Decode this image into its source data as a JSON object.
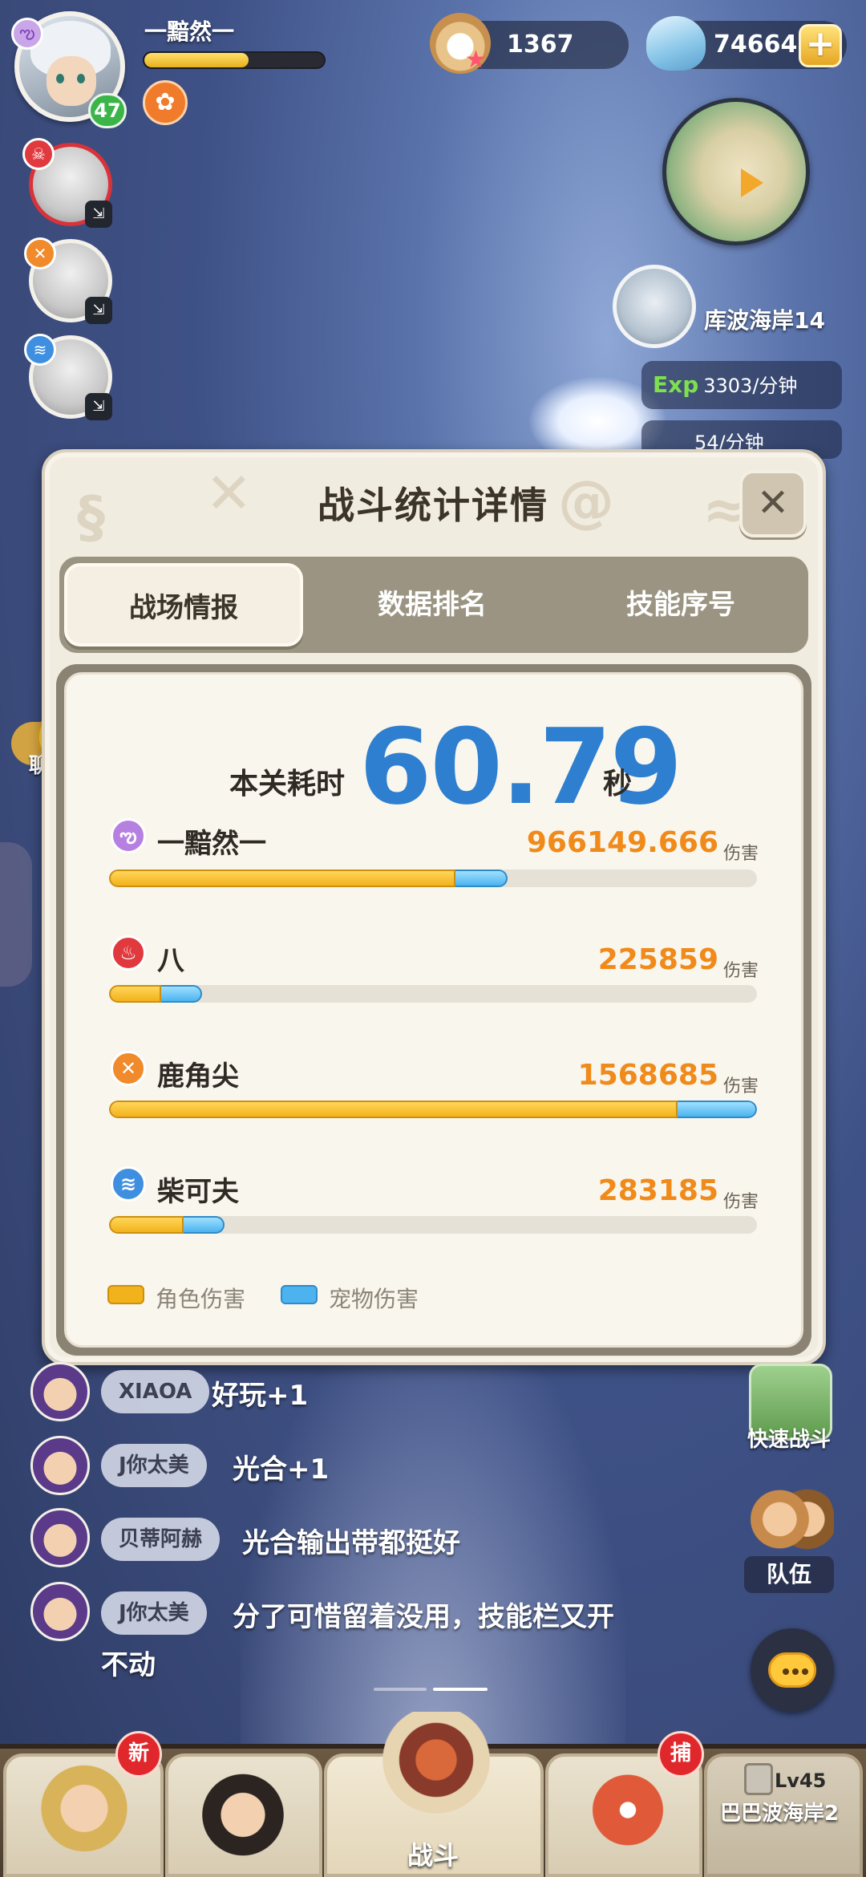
{
  "colors": {
    "accent_blue": "#2e7fd0",
    "damage_orange": "#f08a1a",
    "character_bar": "#f2b21c",
    "pet_bar": "#4cb3ef",
    "panel_bg": "#f9f6ee"
  },
  "hud": {
    "player_name": "一黯然一",
    "player_level": "47",
    "player_exp_fraction": 0.58,
    "pearls": "1367",
    "shells": "74664",
    "stage_name": "库波海岸14",
    "exp_rate_label": "Exp",
    "exp_rate_value": "3303/分钟",
    "gold_rate_value": "54/分钟"
  },
  "chat_tab": {
    "label": "聊天"
  },
  "modal": {
    "title": "战斗统计详情",
    "close_icon": "close-x",
    "tabs": [
      {
        "label": "战场情报",
        "active": true
      },
      {
        "label": "数据排名",
        "active": false
      },
      {
        "label": "技能序号",
        "active": false
      }
    ],
    "time": {
      "label": "本关耗时",
      "value": "60.79",
      "unit": "秒"
    },
    "damage_unit": "伤害",
    "bar_scale_max": 1568685,
    "rows": [
      {
        "name": "一黯然一",
        "icon": "purple-swirl-icon",
        "icon_color": "#b680e0",
        "damage": "966149.666",
        "char_fraction": 0.535,
        "pet_fraction": 0.08
      },
      {
        "name": "八",
        "icon": "red-flame-icon",
        "icon_color": "#e0393e",
        "damage": "225859",
        "char_fraction": 0.08,
        "pet_fraction": 0.063
      },
      {
        "name": "鹿角尖",
        "icon": "orange-cross-icon",
        "icon_color": "#f08a2a",
        "damage": "1568685",
        "char_fraction": 0.878,
        "pet_fraction": 0.122
      },
      {
        "name": "柴可夫",
        "icon": "blue-wave-icon",
        "icon_color": "#3f8fe0",
        "damage": "283185",
        "char_fraction": 0.115,
        "pet_fraction": 0.063
      }
    ],
    "legend": [
      {
        "label": "角色伤害",
        "color": "#f2b21c"
      },
      {
        "label": "宠物伤害",
        "color": "#4cb3ef"
      }
    ]
  },
  "chat": [
    {
      "name": "XIAOA",
      "text": "好玩+1"
    },
    {
      "name": "J你太美",
      "text": "光合+1"
    },
    {
      "name": "贝蒂阿赫",
      "text": "光合输出带都挺好"
    },
    {
      "name": "J你太美",
      "text": "分了可惜留着没用，技能栏又开",
      "text2": "不动"
    }
  ],
  "side_buttons": {
    "quick_battle": "快速战斗",
    "team": "队伍"
  },
  "bottom_nav": {
    "badge_new": "新",
    "badge_catch": "捕",
    "center_label": "战斗",
    "locked_level": "Lv45",
    "locked_stage": "巴巴波海岸2"
  }
}
